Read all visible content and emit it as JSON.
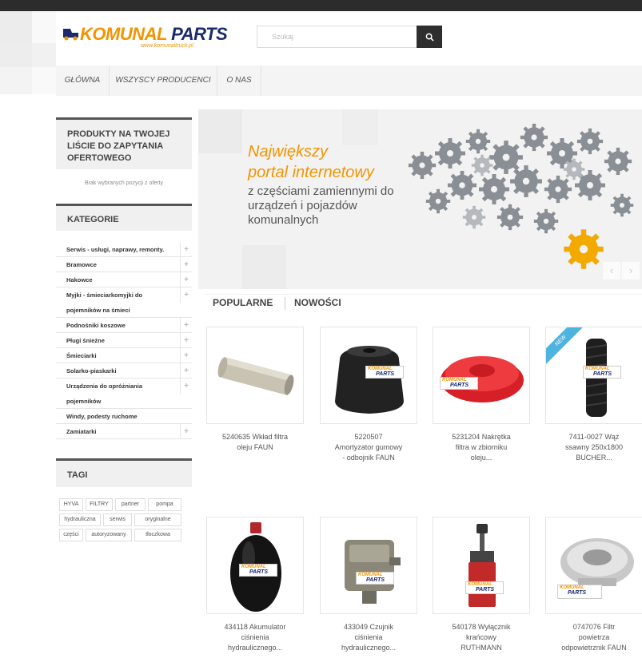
{
  "brand": {
    "logo_main": "KOMUNAL",
    "logo_second": "PARTS",
    "logo_url": "www.komunaltruck.pl",
    "orange": "#f29400",
    "navy": "#1a2a6c"
  },
  "search": {
    "placeholder": "Szukaj",
    "button_icon": "search-icon"
  },
  "nav": {
    "items": [
      {
        "label": "Główna"
      },
      {
        "label": "Wszyscy producenci"
      },
      {
        "label": "O nas"
      }
    ]
  },
  "sidebar": {
    "offer_title": "Produkty na Twojej liście do zapytania ofertowego",
    "offer_empty": "Brak wybranych pozycji z oferty",
    "categories_title": "Kategorie",
    "categories": [
      {
        "label": "Serwis - usługi, naprawy, remonty.",
        "expandable": true
      },
      {
        "label": "Bramowce",
        "expandable": true
      },
      {
        "label": "Hakowce",
        "expandable": true
      },
      {
        "label": "Myjki - śmieciarkomyjki do",
        "label2": "pojemników na śmieci",
        "expandable": true
      },
      {
        "label": "Podnośniki koszowe",
        "expandable": true
      },
      {
        "label": "Pługi śnieżne",
        "expandable": true
      },
      {
        "label": "Śmieciarki",
        "expandable": true
      },
      {
        "label": "Solarko-piaskarki",
        "expandable": true
      },
      {
        "label": "Urządzenia do opróżniania",
        "label2": "pojemników",
        "expandable": true
      },
      {
        "label": "Windy, podesty ruchome",
        "expandable": false
      },
      {
        "label": "Zamiatarki",
        "expandable": true
      }
    ],
    "tags_title": "Tagi",
    "tags": [
      "HYVA",
      "FILTRY",
      "partner",
      "pompa",
      "hydrauliczna",
      "serwis",
      "oryginalne",
      "części",
      "autoryzowany",
      "tłoczkowa"
    ]
  },
  "banner": {
    "headline_1": "Największy",
    "headline_2": "portal internetowy",
    "subline": "z częściami zamiennymi do urządzeń i pojazdów komunalnych",
    "prev_icon": "chevron-left-icon",
    "next_icon": "chevron-right-icon"
  },
  "tabs": [
    {
      "label": "Popularne"
    },
    {
      "label": "Nowości"
    }
  ],
  "products": [
    {
      "line1": "5240635 Wkład filtra",
      "line2": "oleju FAUN",
      "line3": "",
      "badge": ""
    },
    {
      "line1": "5220507",
      "line2": "Amortyzator gumowy",
      "line3": "- odbojnik FAUN",
      "badge": ""
    },
    {
      "line1": "5231204 Nakrętka",
      "line2": "filtra w zbiorniku",
      "line3": "oleju...",
      "badge": ""
    },
    {
      "line1": "7411-0027 Wąż",
      "line2": "ssawny 250x1800",
      "line3": "BUCHER...",
      "badge": "NEW"
    },
    {
      "line1": "434118 Akumulator",
      "line2": "ciśnienia",
      "line3": "hydraulicznego...",
      "badge": ""
    },
    {
      "line1": "433049 Czujnik",
      "line2": "ciśnienia",
      "line3": "hydraulicznego...",
      "badge": ""
    },
    {
      "line1": "540178 Wyłącznik",
      "line2": "krańcowy",
      "line3": "RUTHMANN",
      "badge": ""
    },
    {
      "line1": "0747076 Filtr",
      "line2": "powietrza",
      "line3": "odpowietrznik FAUN",
      "badge": ""
    }
  ]
}
